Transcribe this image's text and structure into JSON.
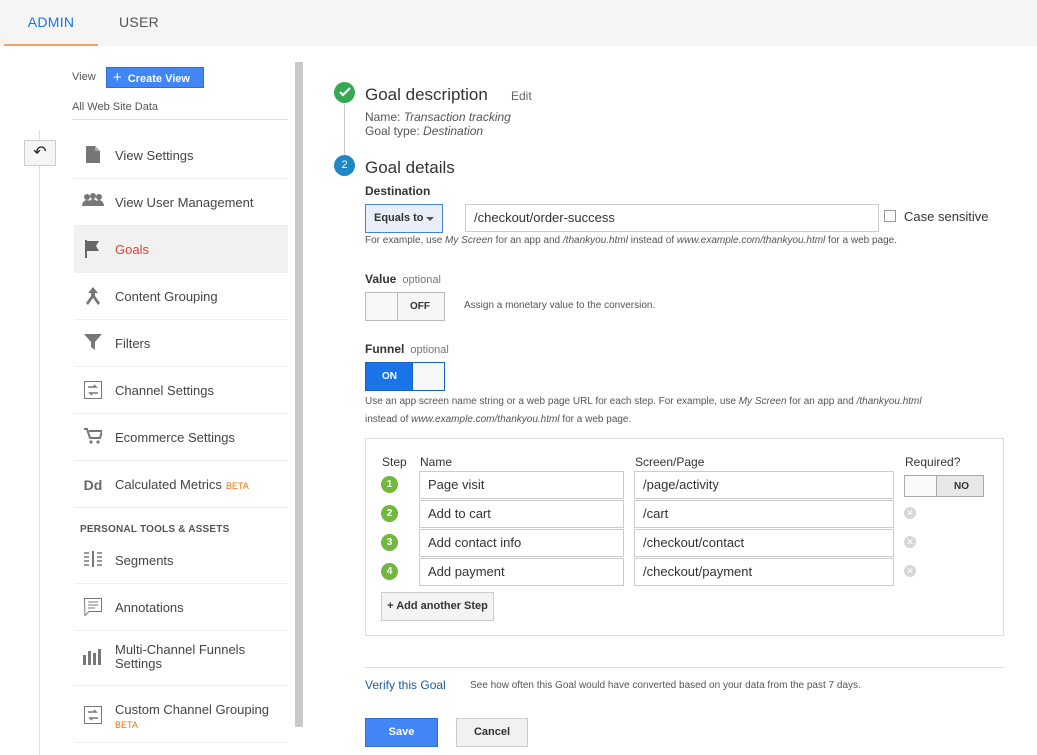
{
  "tabs": {
    "admin": "ADMIN",
    "user": "USER"
  },
  "sidebar": {
    "view_label": "View",
    "create_view": "Create View",
    "view_name": "All Web Site Data",
    "items": [
      {
        "label": "View Settings",
        "icon": "document-icon"
      },
      {
        "label": "View User Management",
        "icon": "users-icon"
      },
      {
        "label": "Goals",
        "icon": "flag-icon"
      },
      {
        "label": "Content Grouping",
        "icon": "grouping-icon"
      },
      {
        "label": "Filters",
        "icon": "filter-icon"
      },
      {
        "label": "Channel Settings",
        "icon": "channel-icon"
      },
      {
        "label": "Ecommerce Settings",
        "icon": "cart-icon"
      },
      {
        "label": "Calculated Metrics",
        "icon": "dd-icon",
        "badge": "BETA"
      }
    ],
    "section_title": "PERSONAL TOOLS & ASSETS",
    "tools": [
      {
        "label": "Segments",
        "icon": "segments-icon"
      },
      {
        "label": "Annotations",
        "icon": "annotation-icon"
      },
      {
        "label": "Multi-Channel Funnels Settings",
        "icon": "bar-chart-icon"
      },
      {
        "label": "Custom Channel Grouping",
        "icon": "channel-icon",
        "badge": "BETA"
      }
    ]
  },
  "goal_description": {
    "title": "Goal description",
    "edit": "Edit",
    "name_label": "Name:",
    "name_value": "Transaction tracking",
    "type_label": "Goal type:",
    "type_value": "Destination"
  },
  "goal_details": {
    "step_number": "2",
    "title": "Goal details",
    "destination_label": "Destination",
    "match_type": "Equals to",
    "destination_value": "/checkout/order-success",
    "case_sensitive": "Case sensitive",
    "destination_hint": {
      "p1": "For example, use ",
      "i1": "My Screen",
      "p2": " for an app and ",
      "i2": "/thankyou.html",
      "p3": " instead of ",
      "i3": "www.example.com/thankyou.html",
      "p4": " for a web page."
    },
    "value_label": "Value",
    "value_optional": "optional",
    "value_toggle": "OFF",
    "value_hint": "Assign a monetary value to the conversion.",
    "funnel_label": "Funnel",
    "funnel_optional": "optional",
    "funnel_toggle": "ON",
    "funnel_hint": {
      "p1": "Use an app screen name string or a web page URL for each step. For example, use ",
      "i1": "My Screen",
      "p2": " for an app and ",
      "i2": "/thankyou.html",
      "p3": "instead of ",
      "i3": "www.example.com/thankyou.html",
      "p4": " for a web page."
    },
    "funnel_table": {
      "headers": {
        "step": "Step",
        "name": "Name",
        "screen": "Screen/Page",
        "required": "Required?"
      },
      "rows": [
        {
          "step": "1",
          "name": "Page visit",
          "screen": "/page/activity"
        },
        {
          "step": "2",
          "name": "Add to cart",
          "screen": "/cart"
        },
        {
          "step": "3",
          "name": "Add contact info",
          "screen": "/checkout/contact"
        },
        {
          "step": "4",
          "name": "Add payment",
          "screen": "/checkout/payment"
        }
      ],
      "required_toggle": "NO",
      "add_step": "+ Add another Step"
    },
    "verify_link": "Verify this Goal",
    "verify_hint": "See how often this Goal would have converted based on your data from the past 7 days.",
    "save": "Save",
    "cancel": "Cancel"
  },
  "colors": {
    "accent": "#1a73e8",
    "active_nav": "#db4437",
    "success": "#34a853",
    "step_green": "#72b83e"
  }
}
